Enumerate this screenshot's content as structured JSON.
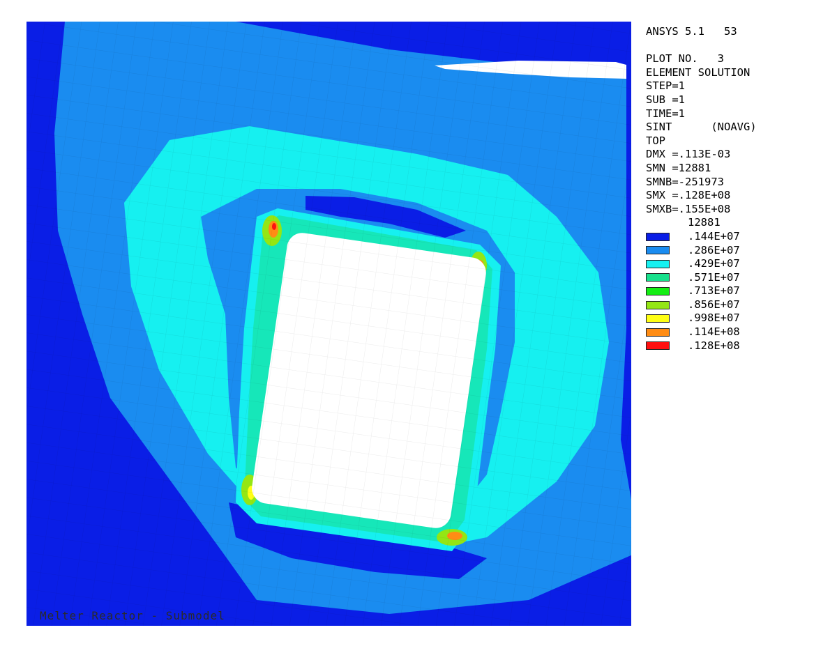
{
  "header": {
    "program": "ANSYS 5.1",
    "plot_id": "53"
  },
  "info": [
    "PLOT NO.   3",
    "ELEMENT SOLUTION",
    "STEP=1",
    "SUB =1",
    "TIME=1",
    "SINT      (NOAVG)",
    "TOP",
    "DMX =.113E-03",
    "SMN =12881",
    "SMNB=-251973",
    "SMX =.128E+08",
    "SMXB=.155E+08"
  ],
  "legend": {
    "first_label": "12881",
    "entries": [
      {
        "label": ".144E+07",
        "color": "#0a1ee6"
      },
      {
        "label": ".286E+07",
        "color": "#1a8cf0"
      },
      {
        "label": ".429E+07",
        "color": "#16f0f0"
      },
      {
        "label": ".571E+07",
        "color": "#18e08c"
      },
      {
        "label": ".713E+07",
        "color": "#14ee14"
      },
      {
        "label": ".856E+07",
        "color": "#94e614"
      },
      {
        "label": ".998E+07",
        "color": "#ffff14"
      },
      {
        "label": ".114E+08",
        "color": "#ff8c14"
      },
      {
        "label": ".128E+08",
        "color": "#ff1010"
      }
    ]
  },
  "plot_caption": "Melter Reactor - Submodel",
  "colors": {
    "background": "#ffffff",
    "dark_blue": "#0a1ee6",
    "medium_blue": "#1a8cf0",
    "cyan": "#16f0f0",
    "teal": "#18e08c",
    "green": "#14ee14",
    "yellow_green": "#94e614",
    "yellow": "#ffff14",
    "orange": "#ff8c14",
    "red": "#ff1010"
  }
}
